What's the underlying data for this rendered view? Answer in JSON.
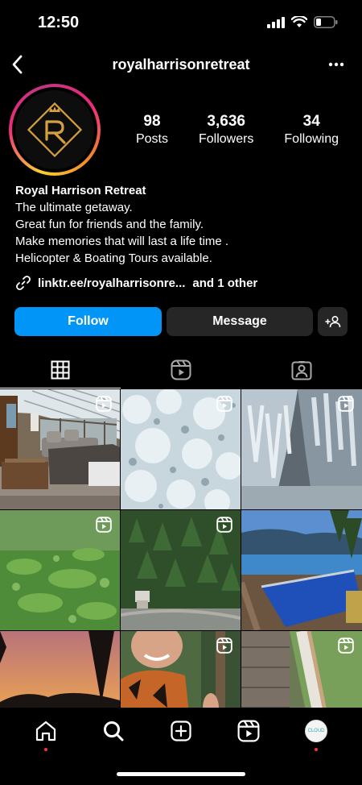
{
  "status": {
    "time": "12:50"
  },
  "header": {
    "username": "royalharrisonretreat"
  },
  "profile": {
    "stats": [
      {
        "value": "98",
        "label": "Posts"
      },
      {
        "value": "3,636",
        "label": "Followers"
      },
      {
        "value": "34",
        "label": "Following"
      }
    ],
    "name": "Royal Harrison Retreat",
    "bio_lines": [
      "The ultimate getaway.",
      "Great fun for friends and the family.",
      "Make memories that will last a life time .",
      "Helicopter & Boating Tours available."
    ],
    "link": "linktr.ee/royalharrisonre...",
    "link_more": "and 1 other"
  },
  "actions": {
    "follow": "Follow",
    "message": "Message"
  },
  "tabs": [
    "grid-icon",
    "reels-icon",
    "tagged-icon"
  ],
  "grid": [
    {
      "scene": "sunroom living room",
      "reel": true
    },
    {
      "scene": "frosted tree branches",
      "reel": true
    },
    {
      "scene": "frozen waterfall",
      "reel": true
    },
    {
      "scene": "clear river water",
      "reel": true
    },
    {
      "scene": "forest aerial",
      "reel": true
    },
    {
      "scene": "lake infinity pool",
      "reel": false
    },
    {
      "scene": "sunset silhouette",
      "reel": false
    },
    {
      "scene": "smiling man",
      "reel": true
    },
    {
      "scene": "deck and lawn",
      "reel": true
    }
  ],
  "bottom_nav": [
    "home-icon",
    "search-icon",
    "create-icon",
    "reels-icon",
    "profile-avatar"
  ],
  "nav_avatar_text": "CLOUD",
  "colors": {
    "follow": "#0095f6",
    "secondary": "#262626",
    "notification": "#ff3040"
  }
}
